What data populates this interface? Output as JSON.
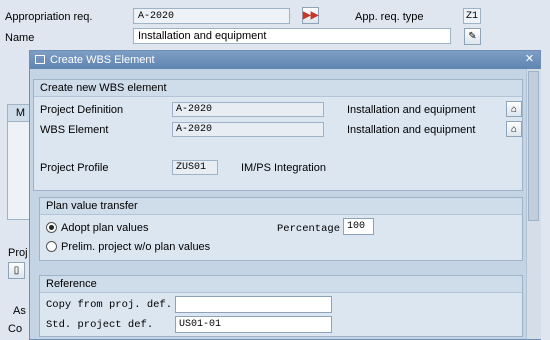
{
  "background": {
    "appropriation_label": "Appropriation req.",
    "appropriation_value": "A-2020",
    "app_req_type_label": "App. req. type",
    "app_req_type_value": "Z1",
    "name_label": "Name",
    "name_value": "Installation and equipment",
    "side_col_header": "M",
    "proj_fragment": "Proj",
    "as_fragment": "As",
    "co_fragment": "Co"
  },
  "dialog": {
    "title": "Create WBS Element",
    "header_panel": {
      "title": "Create new WBS element",
      "project_definition_label": "Project Definition",
      "project_definition_value": "A-2020",
      "project_definition_desc": "Installation and equipment",
      "wbs_element_label": "WBS Element",
      "wbs_element_value": "A-2020",
      "wbs_element_desc": "Installation and equipment",
      "project_profile_label": "Project Profile",
      "project_profile_value": "ZUS01",
      "project_profile_desc": "IM/PS Integration"
    },
    "plan_value_panel": {
      "title": "Plan value transfer",
      "adopt_label": "Adopt plan values",
      "prelim_label": "Prelim. project w/o plan values",
      "percentage_label": "Percentage",
      "percentage_value": "100",
      "selected": "adopt"
    },
    "reference_panel": {
      "title": "Reference",
      "copy_label": "Copy from proj. def.",
      "copy_value": "",
      "std_label": "Std. project def.",
      "std_value": "US01-01"
    }
  },
  "colors": {
    "titlebar": "#6a8fbb",
    "panel_bg": "#dce6f1",
    "dialog_bg": "#c5d4e4",
    "screen_bg": "#dfe6ef"
  }
}
